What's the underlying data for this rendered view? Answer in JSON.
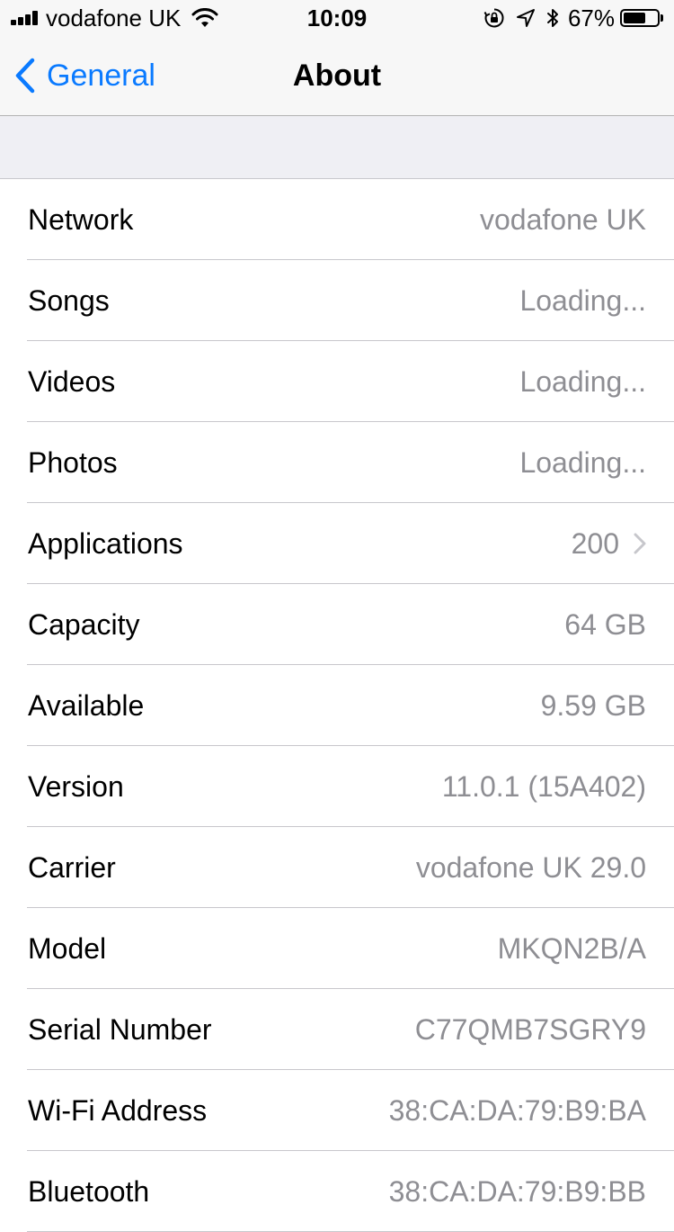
{
  "status_bar": {
    "carrier": "vodafone UK",
    "time": "10:09",
    "battery_percent": "67%",
    "battery_level": 0.67,
    "icons": [
      "signal-bars-icon",
      "wifi-icon",
      "orientation-lock-icon",
      "location-arrow-icon",
      "bluetooth-icon",
      "battery-icon"
    ]
  },
  "nav": {
    "back_label": "General",
    "title": "About"
  },
  "rows": [
    {
      "label": "Network",
      "value": "vodafone UK"
    },
    {
      "label": "Songs",
      "value": "Loading..."
    },
    {
      "label": "Videos",
      "value": "Loading..."
    },
    {
      "label": "Photos",
      "value": "Loading..."
    },
    {
      "label": "Applications",
      "value": "200",
      "chevron": true
    },
    {
      "label": "Capacity",
      "value": "64 GB"
    },
    {
      "label": "Available",
      "value": "9.59 GB"
    },
    {
      "label": "Version",
      "value": "11.0.1 (15A402)"
    },
    {
      "label": "Carrier",
      "value": "vodafone UK 29.0"
    },
    {
      "label": "Model",
      "value": "MKQN2B/A"
    },
    {
      "label": "Serial Number",
      "value": "C77QMB7SGRY9"
    },
    {
      "label": "Wi-Fi Address",
      "value": "38:CA:DA:79:B9:BA"
    },
    {
      "label": "Bluetooth",
      "value": "38:CA:DA:79:B9:BB"
    }
  ],
  "colors": {
    "accent": "#0a7aff",
    "value_text": "#8e8e93",
    "background": "#efeff4",
    "separator": "#c8c7cc"
  }
}
